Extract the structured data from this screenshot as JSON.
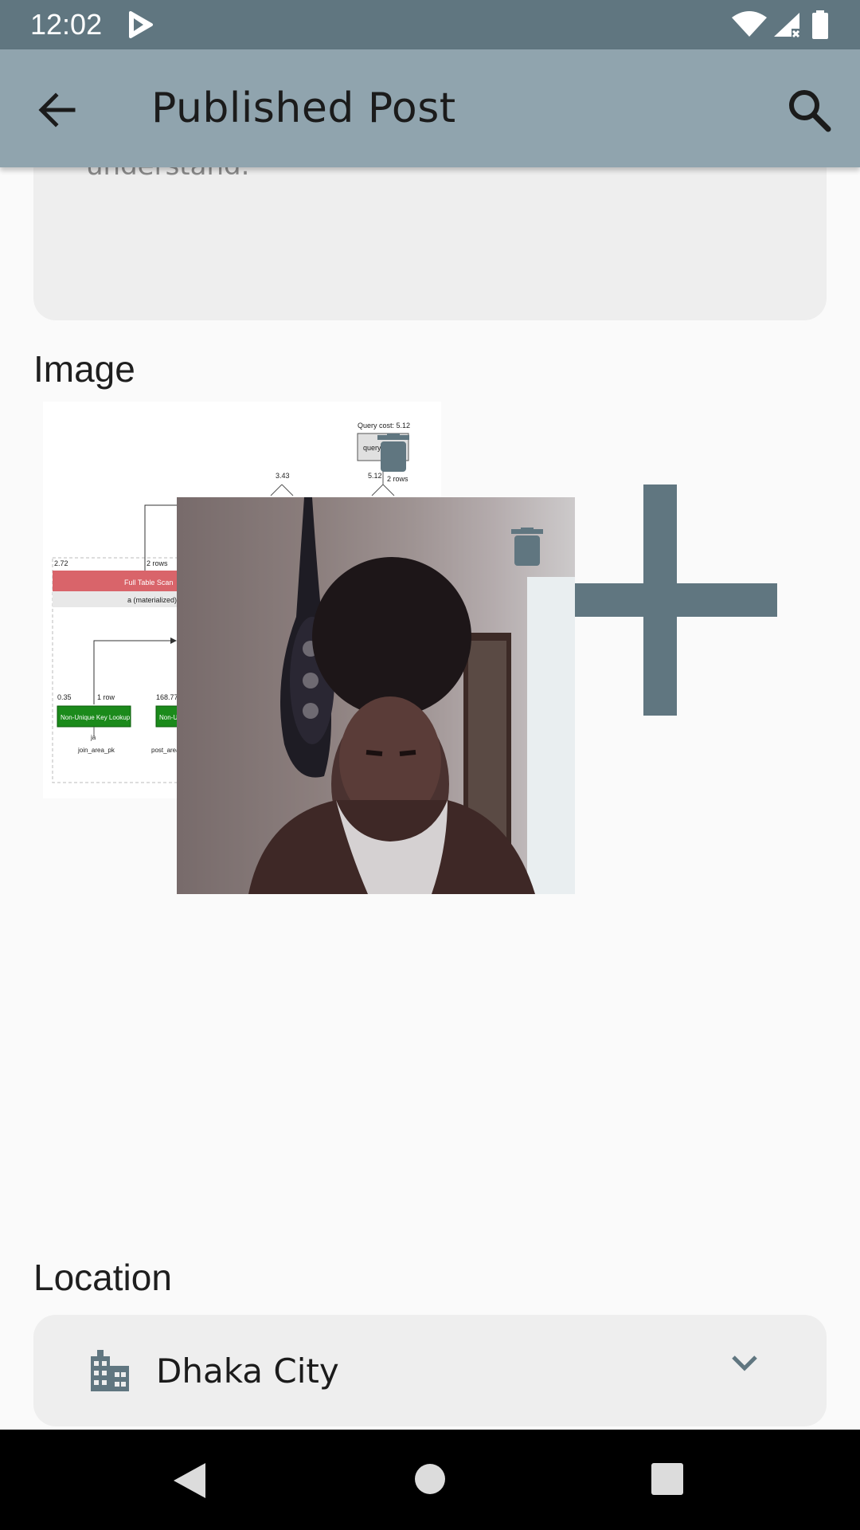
{
  "status_bar": {
    "time": "12:02",
    "icons": [
      "play-store-icon",
      "wifi-icon",
      "signal-icon",
      "battery-icon"
    ]
  },
  "app_bar": {
    "title": "Published Post",
    "back_icon": "arrow-back-icon",
    "search_icon": "search-icon",
    "background": "#90a4ae"
  },
  "description": {
    "partial_text": "understand."
  },
  "image_section": {
    "label": "Image",
    "images": [
      {
        "name": "query-plan-diagram",
        "delete_icon": "trash-icon"
      },
      {
        "name": "selfie-photo",
        "delete_icon": "trash-icon"
      }
    ],
    "add_icon": "plus-icon"
  },
  "query_plan": {
    "query_cost": "Query cost: 5.12",
    "query_box": "query",
    "cost_a": "3.43",
    "cost_b": "5.12",
    "rows_b": "2 rows",
    "cost_scan": "2.72",
    "rows_scan": "2 rows",
    "full_scan": "Full Table Scan",
    "materialized": "a (materialized)",
    "cost_lookup": "0.35",
    "rows_lookup": "1 row",
    "cost_lookup2": "168.77",
    "lookup_label": "Non-Unique Key Lookup",
    "lookup_label2": "Non-U",
    "table_ja": "ja",
    "key_ja": "join_area_pk",
    "key_post": "post_area"
  },
  "location_section": {
    "label": "Location",
    "value": "Dhaka City",
    "icon": "building-icon",
    "dropdown_icon": "chevron-down-icon"
  },
  "nav_bar": {
    "icons": [
      "nav-back-icon",
      "nav-home-icon",
      "nav-recents-icon"
    ]
  },
  "colors": {
    "status_bar": "#607680",
    "icon_accent": "#607680",
    "page_bg": "#fafafa",
    "field_bg": "#eeeeee"
  }
}
